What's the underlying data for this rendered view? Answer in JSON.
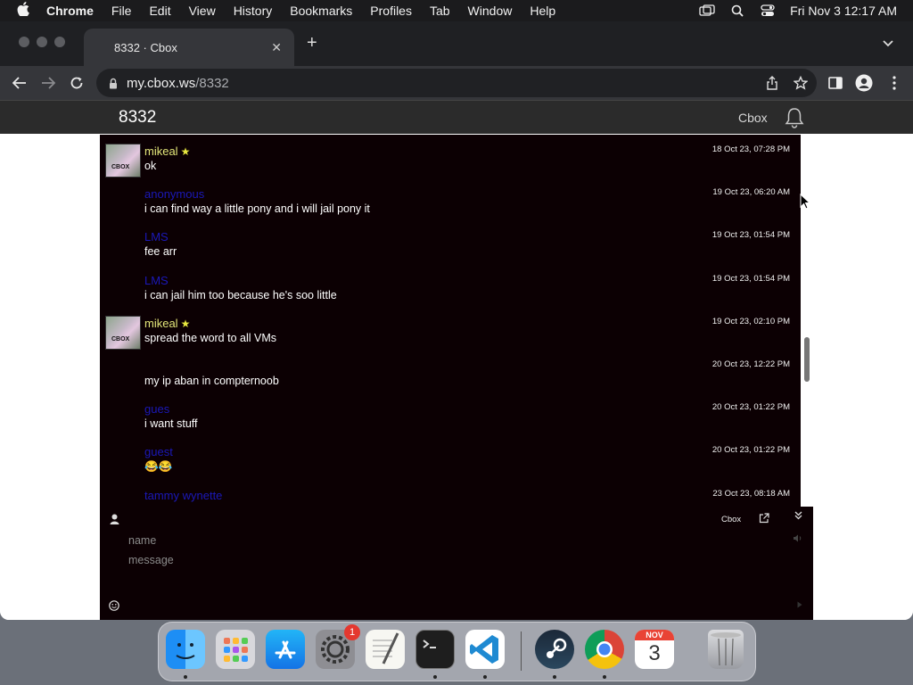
{
  "menubar": {
    "app_name": "Chrome",
    "items": [
      "File",
      "Edit",
      "View",
      "History",
      "Bookmarks",
      "Profiles",
      "Tab",
      "Window",
      "Help"
    ],
    "clock": "Fri Nov 3  12:17 AM"
  },
  "browser": {
    "tab_title": "8332 · Cbox",
    "url_host": "my.cbox.ws",
    "url_path": "/8332"
  },
  "cbox": {
    "room_title": "8332",
    "brand": "Cbox",
    "messages": [
      {
        "user": "mikeal",
        "text": "ok",
        "time": "18 Oct 23, 07:28 PM"
      },
      {
        "user": "anonymous",
        "text": "i can find way a little pony and i will jail pony it",
        "time": "19 Oct 23, 06:20 AM"
      },
      {
        "user": "LMS",
        "text": "fee arr",
        "time": "19 Oct 23, 01:54 PM"
      },
      {
        "user": "LMS",
        "text": "i can jail him too because he's soo little",
        "time": "19 Oct 23, 01:54 PM"
      },
      {
        "user": "mikeal",
        "text": "spread the word to all VMs",
        "time": "19 Oct 23, 02:10 PM"
      },
      {
        "user": "",
        "text": "my ip aban in compternoob",
        "time": "20 Oct 23, 12:22 PM"
      },
      {
        "user": "gues",
        "text": "i want stuff",
        "time": "20 Oct 23, 01:22 PM"
      },
      {
        "user": "guest",
        "text": "😂😂",
        "time": "20 Oct 23, 01:22 PM"
      },
      {
        "user": "tammy wynette",
        "text": "",
        "time": "23 Oct 23, 08:18 AM"
      }
    ],
    "compose": {
      "brand": "Cbox",
      "name_placeholder": "name",
      "message_placeholder": "message"
    }
  },
  "dock": {
    "apps": [
      "Finder",
      "Launchpad",
      "App Store",
      "System Settings",
      "TextEdit",
      "Terminal",
      "Visual Studio Code",
      "Steam",
      "Google Chrome",
      "Calendar",
      "Trash"
    ],
    "settings_badge": "1",
    "calendar_month": "NOV",
    "calendar_day": "3"
  },
  "colors": {
    "chat_bg": "#0c0003",
    "header_bg": "#2b2b2b",
    "username_gold": "#e3e67a",
    "username_blue": "#1b18b8"
  }
}
